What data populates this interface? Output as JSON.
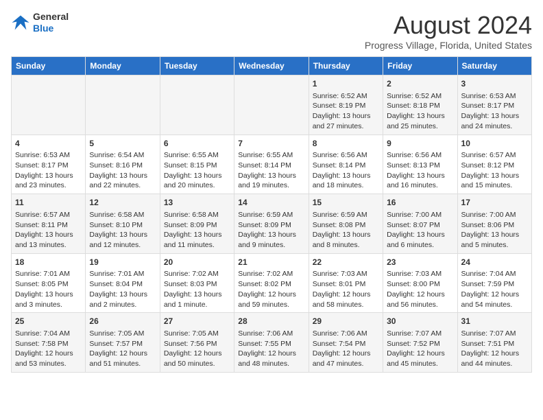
{
  "header": {
    "logo_line1": "General",
    "logo_line2": "Blue",
    "month_year": "August 2024",
    "location": "Progress Village, Florida, United States"
  },
  "days_of_week": [
    "Sunday",
    "Monday",
    "Tuesday",
    "Wednesday",
    "Thursday",
    "Friday",
    "Saturday"
  ],
  "weeks": [
    [
      {
        "day": "",
        "info": ""
      },
      {
        "day": "",
        "info": ""
      },
      {
        "day": "",
        "info": ""
      },
      {
        "day": "",
        "info": ""
      },
      {
        "day": "1",
        "info": "Sunrise: 6:52 AM\nSunset: 8:19 PM\nDaylight: 13 hours and 27 minutes."
      },
      {
        "day": "2",
        "info": "Sunrise: 6:52 AM\nSunset: 8:18 PM\nDaylight: 13 hours and 25 minutes."
      },
      {
        "day": "3",
        "info": "Sunrise: 6:53 AM\nSunset: 8:17 PM\nDaylight: 13 hours and 24 minutes."
      }
    ],
    [
      {
        "day": "4",
        "info": "Sunrise: 6:53 AM\nSunset: 8:17 PM\nDaylight: 13 hours and 23 minutes."
      },
      {
        "day": "5",
        "info": "Sunrise: 6:54 AM\nSunset: 8:16 PM\nDaylight: 13 hours and 22 minutes."
      },
      {
        "day": "6",
        "info": "Sunrise: 6:55 AM\nSunset: 8:15 PM\nDaylight: 13 hours and 20 minutes."
      },
      {
        "day": "7",
        "info": "Sunrise: 6:55 AM\nSunset: 8:14 PM\nDaylight: 13 hours and 19 minutes."
      },
      {
        "day": "8",
        "info": "Sunrise: 6:56 AM\nSunset: 8:14 PM\nDaylight: 13 hours and 18 minutes."
      },
      {
        "day": "9",
        "info": "Sunrise: 6:56 AM\nSunset: 8:13 PM\nDaylight: 13 hours and 16 minutes."
      },
      {
        "day": "10",
        "info": "Sunrise: 6:57 AM\nSunset: 8:12 PM\nDaylight: 13 hours and 15 minutes."
      }
    ],
    [
      {
        "day": "11",
        "info": "Sunrise: 6:57 AM\nSunset: 8:11 PM\nDaylight: 13 hours and 13 minutes."
      },
      {
        "day": "12",
        "info": "Sunrise: 6:58 AM\nSunset: 8:10 PM\nDaylight: 13 hours and 12 minutes."
      },
      {
        "day": "13",
        "info": "Sunrise: 6:58 AM\nSunset: 8:09 PM\nDaylight: 13 hours and 11 minutes."
      },
      {
        "day": "14",
        "info": "Sunrise: 6:59 AM\nSunset: 8:09 PM\nDaylight: 13 hours and 9 minutes."
      },
      {
        "day": "15",
        "info": "Sunrise: 6:59 AM\nSunset: 8:08 PM\nDaylight: 13 hours and 8 minutes."
      },
      {
        "day": "16",
        "info": "Sunrise: 7:00 AM\nSunset: 8:07 PM\nDaylight: 13 hours and 6 minutes."
      },
      {
        "day": "17",
        "info": "Sunrise: 7:00 AM\nSunset: 8:06 PM\nDaylight: 13 hours and 5 minutes."
      }
    ],
    [
      {
        "day": "18",
        "info": "Sunrise: 7:01 AM\nSunset: 8:05 PM\nDaylight: 13 hours and 3 minutes."
      },
      {
        "day": "19",
        "info": "Sunrise: 7:01 AM\nSunset: 8:04 PM\nDaylight: 13 hours and 2 minutes."
      },
      {
        "day": "20",
        "info": "Sunrise: 7:02 AM\nSunset: 8:03 PM\nDaylight: 13 hours and 1 minute."
      },
      {
        "day": "21",
        "info": "Sunrise: 7:02 AM\nSunset: 8:02 PM\nDaylight: 12 hours and 59 minutes."
      },
      {
        "day": "22",
        "info": "Sunrise: 7:03 AM\nSunset: 8:01 PM\nDaylight: 12 hours and 58 minutes."
      },
      {
        "day": "23",
        "info": "Sunrise: 7:03 AM\nSunset: 8:00 PM\nDaylight: 12 hours and 56 minutes."
      },
      {
        "day": "24",
        "info": "Sunrise: 7:04 AM\nSunset: 7:59 PM\nDaylight: 12 hours and 54 minutes."
      }
    ],
    [
      {
        "day": "25",
        "info": "Sunrise: 7:04 AM\nSunset: 7:58 PM\nDaylight: 12 hours and 53 minutes."
      },
      {
        "day": "26",
        "info": "Sunrise: 7:05 AM\nSunset: 7:57 PM\nDaylight: 12 hours and 51 minutes."
      },
      {
        "day": "27",
        "info": "Sunrise: 7:05 AM\nSunset: 7:56 PM\nDaylight: 12 hours and 50 minutes."
      },
      {
        "day": "28",
        "info": "Sunrise: 7:06 AM\nSunset: 7:55 PM\nDaylight: 12 hours and 48 minutes."
      },
      {
        "day": "29",
        "info": "Sunrise: 7:06 AM\nSunset: 7:54 PM\nDaylight: 12 hours and 47 minutes."
      },
      {
        "day": "30",
        "info": "Sunrise: 7:07 AM\nSunset: 7:52 PM\nDaylight: 12 hours and 45 minutes."
      },
      {
        "day": "31",
        "info": "Sunrise: 7:07 AM\nSunset: 7:51 PM\nDaylight: 12 hours and 44 minutes."
      }
    ]
  ]
}
